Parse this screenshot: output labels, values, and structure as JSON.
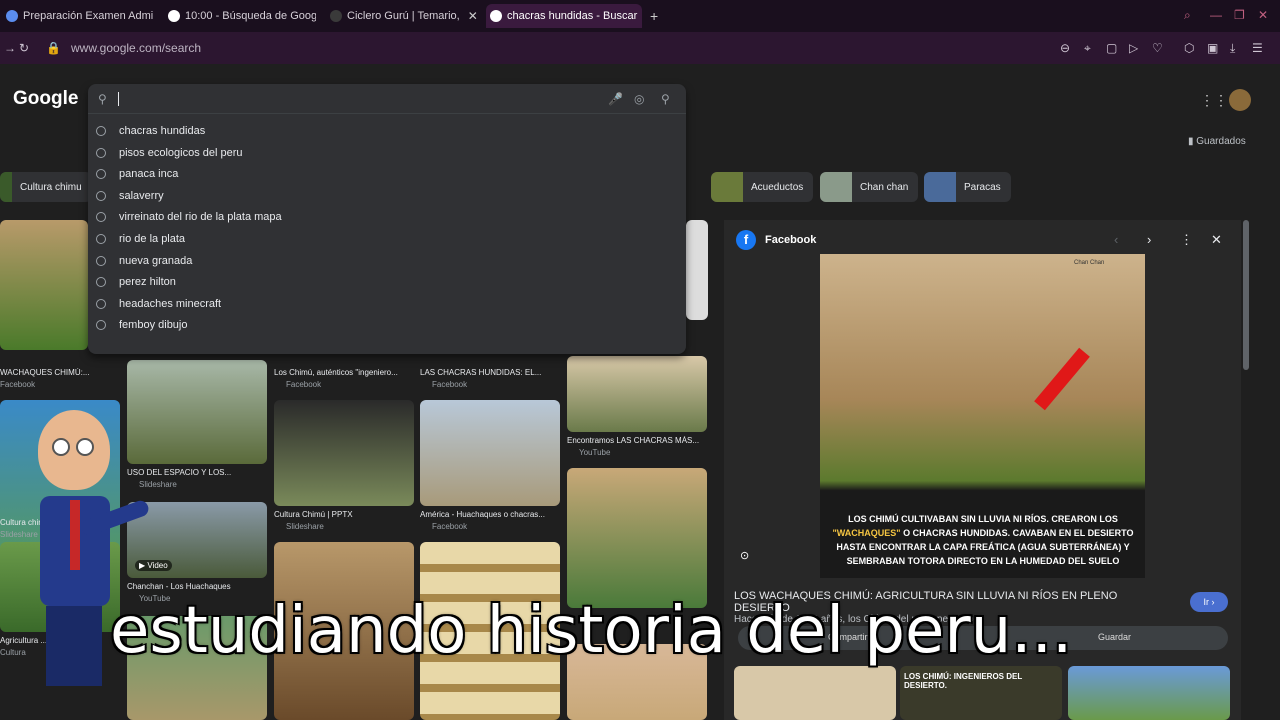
{
  "tabs": [
    {
      "label": "Preparación Examen Admi",
      "active": false
    },
    {
      "label": "10:00 - Búsqueda de Goog",
      "active": false
    },
    {
      "label": "Ciclero Gurú | Temario,",
      "active": false
    },
    {
      "label": "chacras hundidas - Buscar",
      "active": true
    }
  ],
  "address": {
    "url": "www.google.com/search"
  },
  "google": {
    "logo": "Google",
    "saved": "Guardados",
    "apps_icon": "apps-grid-icon"
  },
  "search": {
    "value": "",
    "suggestions": [
      "chacras hundidas",
      "pisos ecologicos del peru",
      "panaca inca",
      "salaverry",
      "virreinato del rio de la plata mapa",
      "rio de la plata",
      "nueva granada",
      "perez hilton",
      "headaches minecraft",
      "femboy dibujo"
    ]
  },
  "chips": [
    "Cultura chimu",
    "Acueductos",
    "Chan chan",
    "Paracas"
  ],
  "results": [
    {
      "caption": "WACHAQUES CHIMÚ:...",
      "source": "Facebook"
    },
    {
      "caption": "Los Chimú, auténticos \"ingeniero...",
      "source": "Facebook"
    },
    {
      "caption": "LAS CHACRAS HUNDIDAS: EL...",
      "source": "Facebook"
    },
    {
      "caption": "Encontramos LAS CHACRAS MÁS...",
      "source": "YouTube"
    },
    {
      "caption": "USO DEL ESPACIO Y LOS...",
      "source": "Slideshare"
    },
    {
      "caption": "Cultura Chimú | PPTX",
      "source": "Slideshare"
    },
    {
      "caption": "América - Huachaques o chacras...",
      "source": "Facebook"
    },
    {
      "caption": "Chanchan - Los Huachaques",
      "source": "YouTube"
    },
    {
      "caption": "Cultura chimu",
      "source": "Slideshare"
    },
    {
      "caption": "Agricultura ... Chimu",
      "source": "Cultura"
    }
  ],
  "panel": {
    "source": "Facebook",
    "image_text_plain1": "LOS CHIMÚ CULTIVABAN SIN LLUVIA NI RÍOS. CREARON LOS",
    "image_text_highlight": "\"WACHAQUES\"",
    "image_text_plain2": "O CHACRAS HUNDIDAS. CAVABAN EN EL DESIERTO HASTA ENCONTRAR LA CAPA FREÁTICA (AGUA SUBTERRÁNEA) Y SEMBRABAN TOTORA DIRECTO EN LA HUMEDAD DEL SUELO",
    "image_label": "Chan Chan",
    "title": "LOS WACHAQUES CHIMÚ: AGRICULTURA SIN LLUVIA NI RÍOS EN PLENO DESIERTO",
    "snippet": "Hace más de 1000 años, los Chimú del norte peruano...",
    "visit_button": "Ir",
    "share": "Compartir",
    "save": "Guardar",
    "related_caption": "LOS CHIMÚ: INGENIEROS DEL DESIERTO."
  },
  "badges": {
    "video": "Video"
  },
  "overlay": {
    "subtitle": "estudiando historia del peru..."
  }
}
